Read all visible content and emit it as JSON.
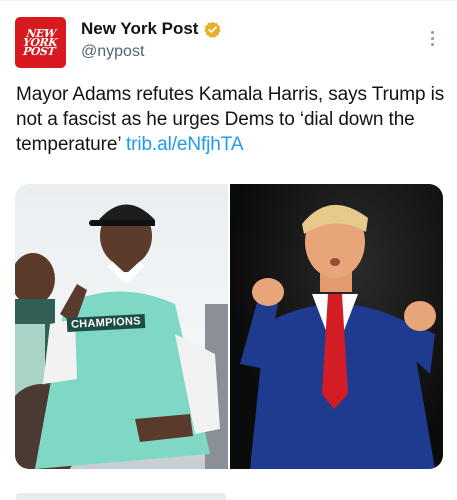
{
  "account": {
    "display_name": "New York Post",
    "handle": "@nypost",
    "avatar_logo_lines": [
      "NEW",
      "YORK",
      "POST"
    ],
    "verified": true,
    "badge_color": "#e8b027",
    "avatar_color": "#d71920"
  },
  "post": {
    "text": "Mayor Adams refutes Kamala Harris, says Trump is not a fascist as he urges Dems to ‘dial down the temperature’",
    "link_text": "trib.al/eNfjhTA",
    "link_color": "#1d9bf0"
  },
  "media": {
    "left_image": {
      "shirt_text": "CHAMPIONS"
    },
    "right_image": {}
  },
  "icons": {
    "more": "more-options-icon",
    "verified": "verified-badge-icon"
  }
}
